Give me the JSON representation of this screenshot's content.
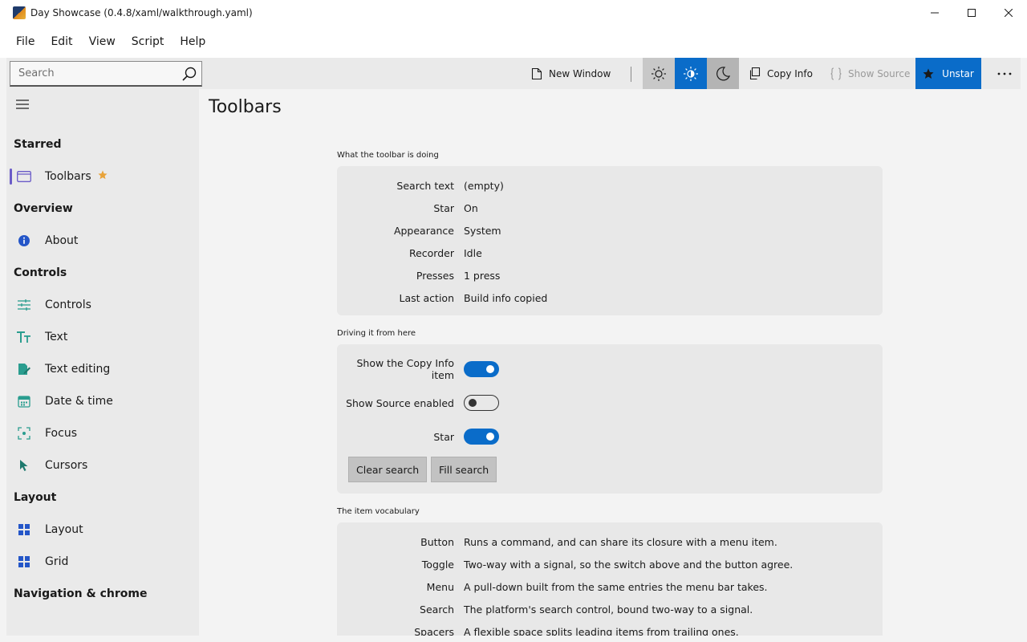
{
  "window": {
    "title": "Day Showcase (0.4.8/xaml/walkthrough.yaml)"
  },
  "menubar": {
    "items": [
      "File",
      "Edit",
      "View",
      "Script",
      "Help"
    ]
  },
  "toolbar": {
    "search_placeholder": "Search",
    "new_window_label": "New Window",
    "copy_info_label": "Copy Info",
    "show_source_label": "Show Source",
    "unstar_label": "Unstar",
    "appearance_selected": "System",
    "accent_color": "#0a6cc9"
  },
  "sidebar": {
    "groups": {
      "starred": "Starred",
      "overview": "Overview",
      "controls": "Controls",
      "layout": "Layout",
      "navigation": "Navigation & chrome"
    },
    "items": {
      "toolbars": "Toolbars",
      "about": "About",
      "controls": "Controls",
      "text": "Text",
      "text_editing": "Text editing",
      "date_time": "Date & time",
      "focus": "Focus",
      "cursors": "Cursors",
      "layout": "Layout",
      "grid": "Grid"
    },
    "selected": "Toolbars"
  },
  "main": {
    "title": "Toolbars",
    "status_section": {
      "label": "What the toolbar is doing",
      "rows": [
        {
          "key": "Search text",
          "value": "(empty)"
        },
        {
          "key": "Star",
          "value": "On"
        },
        {
          "key": "Appearance",
          "value": "System"
        },
        {
          "key": "Recorder",
          "value": "Idle"
        },
        {
          "key": "Presses",
          "value": "1 press"
        },
        {
          "key": "Last action",
          "value": "Build info copied"
        }
      ]
    },
    "drive_section": {
      "label": "Driving it from here",
      "toggles": [
        {
          "label": "Show the Copy Info item",
          "on": true
        },
        {
          "label": "Show Source enabled",
          "on": false
        },
        {
          "label": "Star",
          "on": true
        }
      ],
      "clear_search_label": "Clear search",
      "fill_search_label": "Fill search"
    },
    "vocab_section": {
      "label": "The item vocabulary",
      "rows": [
        {
          "key": "Button",
          "value": "Runs a command, and can share its closure with a menu item."
        },
        {
          "key": "Toggle",
          "value": "Two-way with a signal, so the switch above and the button agree."
        },
        {
          "key": "Menu",
          "value": "A pull-down built from the same entries the menu bar takes."
        },
        {
          "key": "Search",
          "value": "The platform's search control, bound two-way to a signal."
        },
        {
          "key": "Spacers",
          "value": "A flexible space splits leading items from trailing ones."
        }
      ]
    }
  }
}
